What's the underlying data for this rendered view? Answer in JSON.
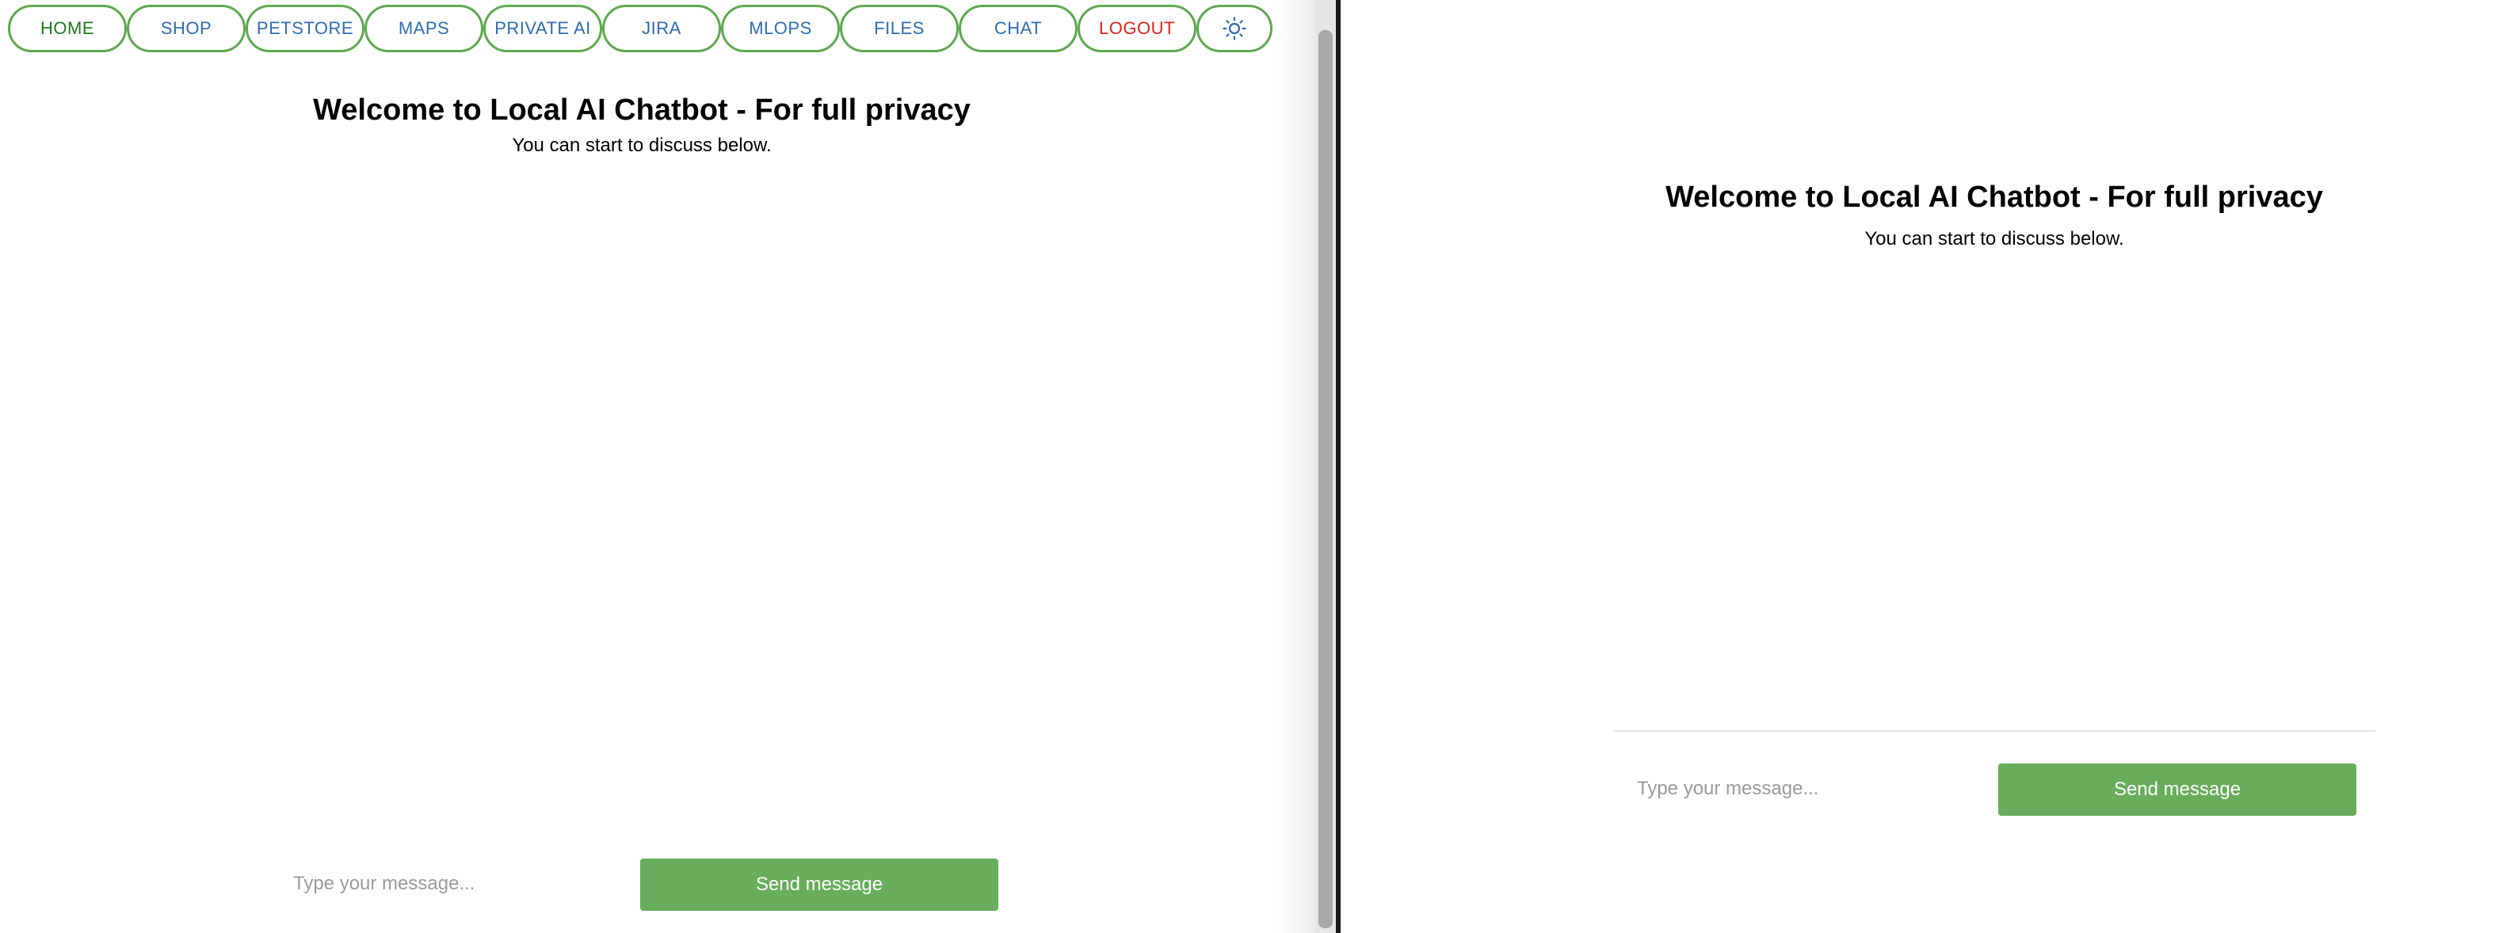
{
  "nav": {
    "items": [
      {
        "label": "HOME",
        "color": "#1f7a1f"
      },
      {
        "label": "SHOP",
        "color": "#2f6bb3"
      },
      {
        "label": "PETSTORE",
        "color": "#2f6bb3"
      },
      {
        "label": "MAPS",
        "color": "#2f6bb3"
      },
      {
        "label": "PRIVATE AI",
        "color": "#2f6bb3"
      },
      {
        "label": "JIRA",
        "color": "#2f6bb3"
      },
      {
        "label": "MLOPS",
        "color": "#2f6bb3"
      },
      {
        "label": "FILES",
        "color": "#2f6bb3"
      },
      {
        "label": "CHAT",
        "color": "#2f6bb3"
      },
      {
        "label": "LOGOUT",
        "color": "#d9231c"
      }
    ],
    "theme_icon": "sun-icon",
    "border_color": "#5fa84f"
  },
  "left_chat": {
    "title": "Welcome to Local AI Chatbot - For full privacy",
    "subtitle": "You can start to discuss below.",
    "input_placeholder": "Type your message...",
    "send_label": "Send message"
  },
  "right_chat": {
    "title": "Welcome to Local AI Chatbot - For full privacy",
    "subtitle": "You can start to discuss below.",
    "input_placeholder": "Type your message...",
    "send_label": "Send message"
  },
  "colors": {
    "accent_green": "#67ad5b",
    "link_blue": "#2f6bb3",
    "logout_red": "#d9231c"
  }
}
